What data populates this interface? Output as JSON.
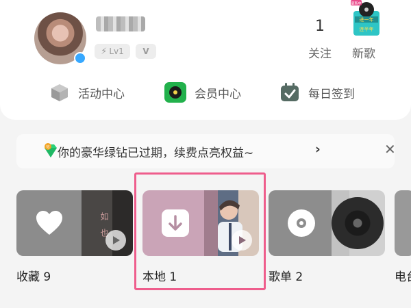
{
  "profile": {
    "level_badge": "Lv1",
    "vip_badge": "V",
    "stats": [
      {
        "value": "1",
        "label": "关注"
      },
      {
        "value": "",
        "label": "新歌"
      }
    ],
    "newsong_art_text": [
      "更新中",
      "进一年",
      "连半年"
    ]
  },
  "quick_links": [
    {
      "label": "活动中心",
      "icon": "cube-icon"
    },
    {
      "label": "会员中心",
      "icon": "vinyl-vip-icon"
    },
    {
      "label": "每日签到",
      "icon": "calendar-check-icon"
    }
  ],
  "banner": {
    "text": "你的豪华绿钻已过期，续费点亮权益~",
    "chevron": "›",
    "close": "✕",
    "gem_badge": "钻"
  },
  "tiles": [
    {
      "label": "收藏 9",
      "icon": "heart-icon",
      "art_text": "如 也"
    },
    {
      "label": "本地 1",
      "icon": "download-icon"
    },
    {
      "label": "歌单 2",
      "icon": "disc-icon"
    },
    {
      "label": "电台",
      "icon": "radio-icon"
    }
  ],
  "colors": {
    "highlight": "#ee5d8c",
    "vip_green": "#22b14c",
    "background": "#f4f4f4",
    "gem": "#2bd27a"
  }
}
